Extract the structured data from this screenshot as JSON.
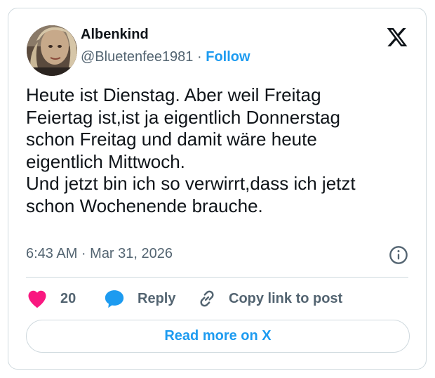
{
  "author": {
    "display_name": "Albenkind",
    "handle": "@Bluetenfee1981",
    "separator": "·",
    "follow_label": "Follow"
  },
  "tweet": {
    "text": "Heute ist Dienstag. Aber weil Freitag\nFeiertag ist,ist ja eigentlich Donnerstag\nschon Freitag und damit wäre heute\neigentlich Mittwoch.\nUnd jetzt bin ich so verwirrt,dass ich jetzt\nschon Wochenende brauche.",
    "timestamp": "6:43 AM · Mar 31, 2026"
  },
  "actions": {
    "like_count": "20",
    "reply_label": "Reply",
    "copy_label": "Copy link to post"
  },
  "read_more_label": "Read more on X",
  "colors": {
    "accent": "#1d9bf0",
    "heart": "#f91880",
    "secondary_text": "#536471",
    "border": "#cfd9de"
  },
  "icons": {
    "brand": "x-logo-icon",
    "info": "info-icon",
    "like": "heart-icon",
    "reply": "speech-bubble-icon",
    "copy": "link-icon"
  }
}
